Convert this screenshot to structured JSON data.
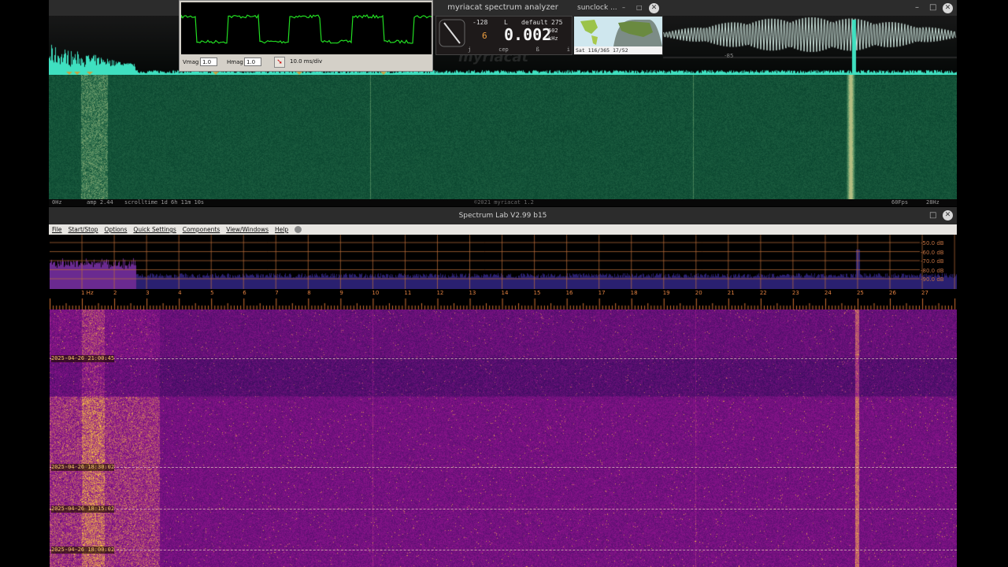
{
  "top_window": {
    "title": "myriacat spectrum analyzer",
    "watermark": "myriacat",
    "status": {
      "left": "0Hz",
      "amp": "amp 2.44",
      "scrolltime": "scrolltime 1d 6h 11m 10s",
      "copyright": "©2021 myriacat 1.2",
      "fps": "60Fps",
      "right": "28Hz"
    },
    "level_label": "-85",
    "spectrum_color": "#3fe0c0",
    "waterfall_color": "#0f5a3a"
  },
  "scope": {
    "vmag_label": "Vmag",
    "vmag_value": "1.0",
    "hmag_label": "Hmag",
    "hmag_value": "1.0",
    "timebase": "10.0 ms/div",
    "trace_color": "#22dd22"
  },
  "gauge": {
    "left_value": "-128",
    "mode": "L",
    "preset": "default",
    "right_value": "275",
    "digit": "6",
    "frequency": "0.002",
    "sub_value": "602",
    "unit": "kHz",
    "buttons": [
      "j",
      "cep",
      "ß",
      "i"
    ]
  },
  "sunclock": {
    "title": "sunclock ...",
    "status": "Sat 116/365 17/52"
  },
  "spectrum_lab": {
    "title": "Spectrum Lab V2.99 b15",
    "menu": [
      "File",
      "Start/Stop",
      "Options",
      "Quick Settings",
      "Components",
      "View/Windows",
      "Help"
    ],
    "db_labels": [
      "-50.0 dB",
      "-60.0 dB",
      "-70.0 dB",
      "-80.0 dB",
      "-90.0 dB"
    ],
    "freq_labels": [
      "1 Hz",
      "2",
      "3",
      "4",
      "5",
      "6",
      "7",
      "8",
      "9",
      "10",
      "11",
      "12",
      "13",
      "14",
      "15",
      "16",
      "17",
      "18",
      "19",
      "20",
      "21",
      "22",
      "23",
      "24",
      "25",
      "26",
      "27"
    ],
    "timestamps": [
      "2025-04-26 21:00:45",
      "2025-04-26 18:30:02",
      "2025-04-26 18:15:02",
      "2025-04-26 18:00:02"
    ],
    "grid_color": "#c0703a"
  }
}
